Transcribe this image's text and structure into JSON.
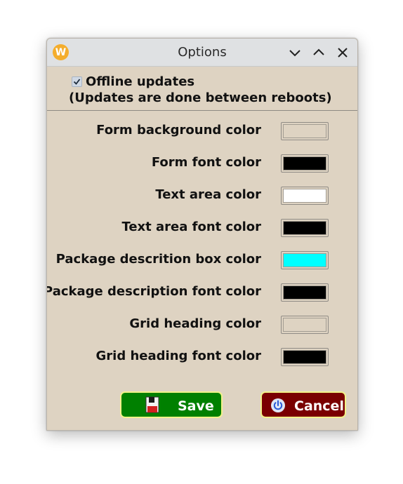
{
  "window": {
    "title": "Options",
    "app_icon_letter": "W"
  },
  "offline": {
    "checked": true,
    "label": "Offline updates",
    "sublabel": "(Updates are done between reboots)"
  },
  "rows": [
    {
      "label": "Form background color",
      "color": "#ded3c2"
    },
    {
      "label": "Form font color",
      "color": "#000000"
    },
    {
      "label": "Text area color",
      "color": "#ffffff"
    },
    {
      "label": "Text area font color",
      "color": "#000000"
    },
    {
      "label": "Package descrition box color",
      "color": "#00ffff"
    },
    {
      "label": "Package description font color",
      "color": "#000000"
    },
    {
      "label": "Grid heading color",
      "color": "#ded3c2"
    },
    {
      "label": "Grid heading font color",
      "color": "#000000"
    }
  ],
  "buttons": {
    "save_label": "Save",
    "save_color": "#008000",
    "cancel_label": "Cancel",
    "cancel_color": "#7a0000"
  }
}
